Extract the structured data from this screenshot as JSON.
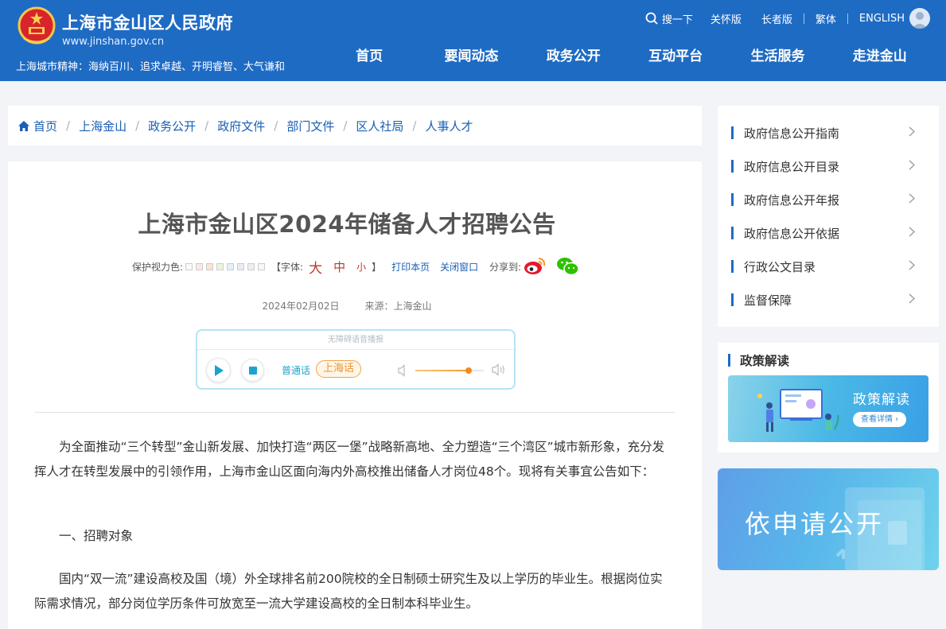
{
  "header": {
    "site_title": "上海市金山区人民政府",
    "site_url": "www.jinshan.gov.cn",
    "city_spirit": "上海城市精神：海纳百川、追求卓越、开明睿智、大气谦和",
    "utility": {
      "search": "搜一下",
      "care": "关怀版",
      "elder": "长者版",
      "traditional": "繁体",
      "english": "ENGLISH"
    },
    "nav": [
      "首页",
      "要闻动态",
      "政务公开",
      "互动平台",
      "生活服务",
      "走进金山"
    ]
  },
  "breadcrumb": [
    "首页",
    "上海金山",
    "政务公开",
    "政府文件",
    "部门文件",
    "区人社局",
    "人事人才"
  ],
  "article": {
    "title": "上海市金山区2024年储备人才招聘公告",
    "tools": {
      "eye_color_label": "保护视力色:",
      "eye_colors": [
        "#fafafa",
        "#fce9e4",
        "#fbe4d6",
        "#eaf6dc",
        "#e1f1fb",
        "#e8ecf8",
        "#eceef0",
        "#f7f7f7"
      ],
      "font_label": "【字体:",
      "font_big": "大",
      "font_mid": "中",
      "font_small": "小",
      "font_close": "】",
      "print": "打印本页",
      "close": "关闭窗口",
      "share": "分享到:"
    },
    "date": "2024年02月02日",
    "source": "来源：上海金山",
    "player": {
      "title": "无障碍语音播报",
      "mandarin": "普通话",
      "shanghainese": "上海话",
      "volume": 0.78
    },
    "paragraphs": [
      "为全面推动“三个转型”金山新发展、加快打造“两区一堡”战略新高地、全力塑造“三个湾区”城市新形象，充分发挥人才在转型发展中的引领作用，上海市金山区面向海内外高校推出储备人才岗位48个。现将有关事宜公告如下：",
      "一、招聘对象",
      "国内“双一流”建设高校及国（境）外全球排名前200院校的全日制硕士研究生及以上学历的毕业生。根据岗位实际需求情况，部分岗位学历条件可放宽至一流大学建设高校的全日制本科毕业生。"
    ]
  },
  "sidebar": {
    "links": [
      "政府信息公开指南",
      "政府信息公开目录",
      "政府信息公开年报",
      "政府信息公开依据",
      "行政公文目录",
      "监督保障"
    ],
    "policy_heading": "政策解读",
    "policy_banner_title": "政策解读",
    "policy_banner_button": "查看详情 ›",
    "apply_title": "依申请公开"
  },
  "colors": {
    "header_bg": "#1e6bc4",
    "link": "#1a5fb4",
    "accent_red": "#c0392b",
    "accent_orange": "#e8952e"
  }
}
